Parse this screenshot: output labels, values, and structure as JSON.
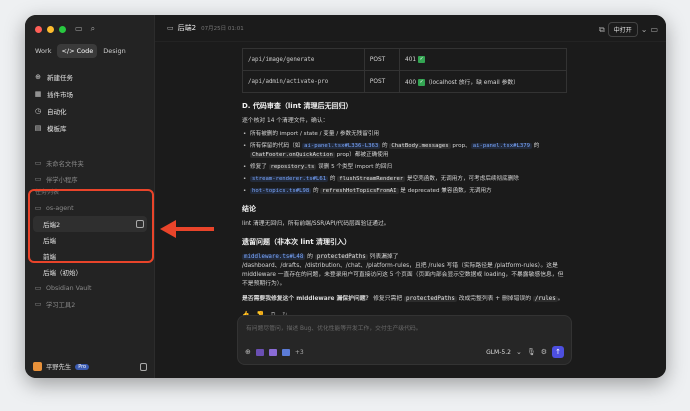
{
  "sidebar": {
    "mode_tabs": [
      "Work",
      "</> Code",
      "Design"
    ],
    "nav": [
      {
        "icon": "plus-circle-icon",
        "glyph": "⊕",
        "label": "新建任务"
      },
      {
        "icon": "store-icon",
        "glyph": "▦",
        "label": "插件市场"
      },
      {
        "icon": "clock-icon",
        "glyph": "◷",
        "label": "自动化"
      },
      {
        "icon": "template-icon",
        "glyph": "▤",
        "label": "模板库"
      }
    ],
    "folders_top": [
      "未命名文件夹",
      "伴学小程序"
    ],
    "section_label": "任务列表",
    "project": "os-agent",
    "children": [
      "后端2",
      "后端",
      "前端",
      "后端（初始）"
    ],
    "folders_bottom": [
      "Obsidian Vault",
      "学习工具2"
    ],
    "user": {
      "name": "平野先生",
      "badge": "Pro"
    }
  },
  "header": {
    "title": "后端2",
    "time": "07月25日 01:01",
    "open_button": "中打开"
  },
  "content": {
    "table_rows": [
      {
        "path": "/api/image/generate",
        "method": "POST",
        "status": "401",
        "note": ""
      },
      {
        "path": "/api/admin/activate-pro",
        "method": "POST",
        "status": "400",
        "note": "（localhost 放行，缺 email 参数）"
      }
    ],
    "section_d": "D. 代码审查（lint 清理后无回归）",
    "section_d_intro": "逐个核对 14 个清理文件，确认：",
    "bullets": {
      "b1": "所有被删的 import / state / 变量 / 参数无残留引用",
      "b2_pre": "所有保留的代码（如 ",
      "b2_link1": "ai-panel.tsx#L336-L363",
      "b2_mid1": " 的 ",
      "b2_code1": "ChatBody.messages",
      "b2_mid2": " prop、",
      "b2_link2": "ai-panel.tsx#L379",
      "b2_mid3": " 的",
      "b2_code2": "ChatFooter.onQuickAction",
      "b2_post": " prop）都被正确使用",
      "b3_pre": "修复了 ",
      "b3_code": "repository.ts",
      "b3_post": " 误删 5 个类型 import 的回归",
      "b4_link": "stream-renderer.ts#L61",
      "b4_mid": " 的 ",
      "b4_code": "flushStreamRenderer",
      "b4_post": " 是空壳函数，无调用方，可考虑后续彻底删除",
      "b5_link": "hot-topics.ts#L98",
      "b5_mid": " 的 ",
      "b5_code": "refreshHotTopicsFromAI",
      "b5_post": " 是 deprecated 兼容函数，无调用方"
    },
    "conclusion_title": "结论",
    "conclusion_text": "lint 清理无回归，所有前端/SSR/API/代码层面验证通过。",
    "legacy_title": "遗留问题（非本次 lint 清理引入）",
    "legacy_link": "middleware.ts#L48",
    "legacy_mid": " 的 ",
    "legacy_code": "protectedPaths",
    "legacy_after": " 列表漏掉了",
    "legacy_text2": "/dashboard、/drafts、/distribution、/chat、/platform-rules，且把 /rules 写错（实际路径是 /platform-rules）。这是 middleware 一直存在的问题，未登录用户可直接访问这 5 个页面（页面内部会显示空数据或 loading，不暴露敏感信息，但不是预期行为）。",
    "question_pre": "是否需要我修复这个 middleware 漏保护问题？",
    "question_post_a": " 修复只需把 ",
    "question_code1": "protectedPaths",
    "question_post_b": " 改成完整列表 + 删掉错误的 ",
    "question_code2": "/rules",
    "question_end": "。"
  },
  "input": {
    "placeholder": "有问题尽管问，描述 Bug、优化性能等开发工作，交付生产级代码。",
    "attach_count": "+3",
    "model": "GLM-5.2"
  }
}
